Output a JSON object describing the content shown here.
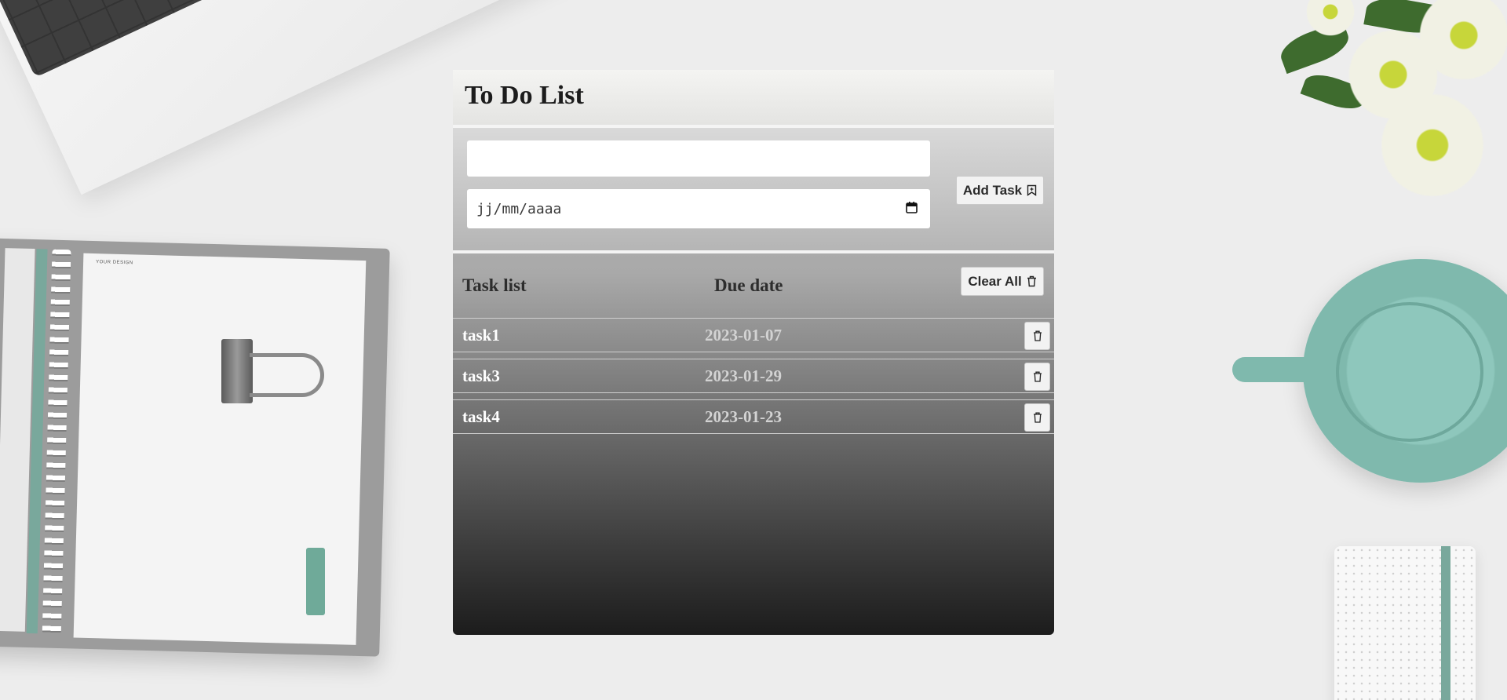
{
  "app": {
    "title": "To Do List"
  },
  "form": {
    "task_value": "",
    "task_placeholder": "",
    "date_value": "jj/mm/aaaa",
    "add_label": "Add Task",
    "add_icon": "bookmark-plus-icon"
  },
  "list": {
    "col_task": "Task list",
    "col_due": "Due date",
    "clear_label": "Clear All",
    "clear_icon": "trash-icon",
    "tasks": [
      {
        "name": "task1",
        "due": "2023-01-07"
      },
      {
        "name": "task3",
        "due": "2023-01-29"
      },
      {
        "name": "task4",
        "due": "2023-01-23"
      }
    ]
  }
}
